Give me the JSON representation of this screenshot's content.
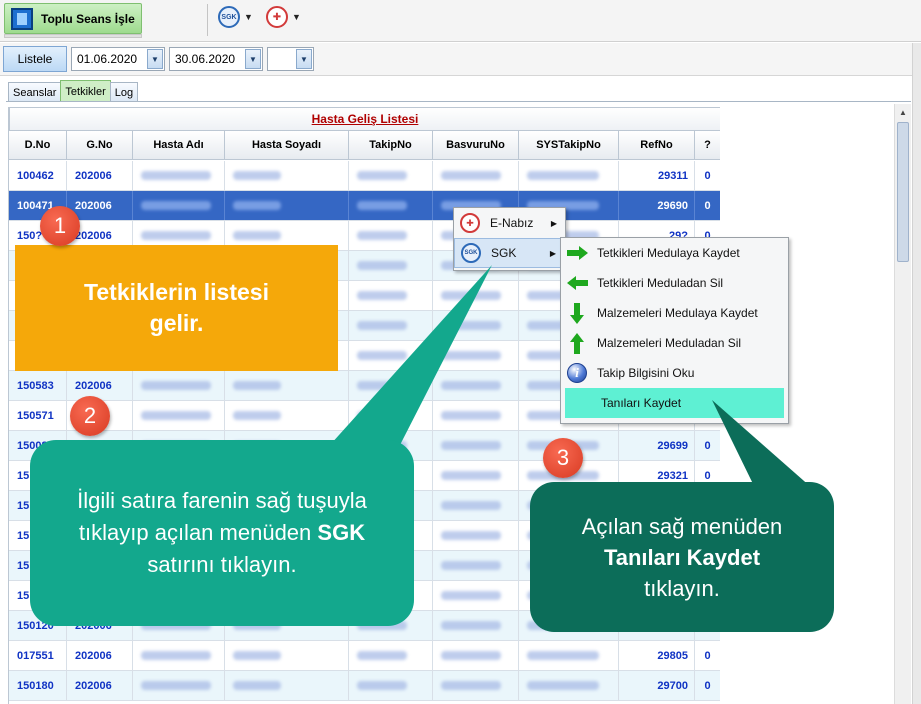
{
  "toolbar": {
    "toplu_label": "Toplu Seans İşle",
    "sgk_logo": "SGK",
    "enabiz_logo": "✚"
  },
  "filter": {
    "listele_label": "Listele",
    "start_date": "01.06.2020",
    "end_date": "30.06.2020",
    "extra_value": ""
  },
  "tabs": [
    {
      "label": "Seanslar"
    },
    {
      "label": "Tetkikler"
    },
    {
      "label": "Log"
    }
  ],
  "grid": {
    "title": "Hasta Geliş Listesi",
    "columns": [
      "D.No",
      "G.No",
      "Hasta Adı",
      "Hasta Soyadı",
      "TakipNo",
      "BasvuruNo",
      "SYSTakipNo",
      "RefNo",
      "?"
    ],
    "rows": [
      {
        "dno": "100462",
        "gno": "202006",
        "refno": "29311",
        "q": "0"
      },
      {
        "dno": "100471",
        "gno": "202006",
        "refno": "29690",
        "q": "0"
      },
      {
        "dno": "150?",
        "gno": "202006",
        "refno": "29?",
        "q": "0"
      },
      {
        "dno": "",
        "gno": "",
        "refno": "",
        "q": ""
      },
      {
        "dno": "",
        "gno": "",
        "refno": "",
        "q": ""
      },
      {
        "dno": "",
        "gno": "",
        "refno": "",
        "q": ""
      },
      {
        "dno": "",
        "gno": "",
        "refno": "",
        "q": ""
      },
      {
        "dno": "150583",
        "gno": "202006",
        "refno": "",
        "q": ""
      },
      {
        "dno": "150571",
        "gno": "?06",
        "refno": "",
        "q": ""
      },
      {
        "dno": "150080",
        "gno": "",
        "refno": "29699",
        "q": "0"
      },
      {
        "dno": "15",
        "gno": "",
        "refno": "29321",
        "q": "0"
      },
      {
        "dno": "15",
        "gno": "",
        "refno": "",
        "q": ""
      },
      {
        "dno": "15",
        "gno": "",
        "refno": "",
        "q": ""
      },
      {
        "dno": "15",
        "gno": "",
        "refno": "",
        "q": ""
      },
      {
        "dno": "15",
        "gno": "",
        "refno": "",
        "q": ""
      },
      {
        "dno": "150120",
        "gno": "202006",
        "refno": "",
        "q": ""
      },
      {
        "dno": "017551",
        "gno": "202006",
        "refno": "29805",
        "q": "0"
      },
      {
        "dno": "150180",
        "gno": "202006",
        "refno": "29700",
        "q": "0"
      }
    ]
  },
  "context_menu": {
    "items": [
      {
        "label": "E-Nabız",
        "icon": "enabiz-icon"
      },
      {
        "label": "SGK",
        "icon": "sgk-icon"
      }
    ]
  },
  "sgk_submenu": {
    "items": [
      {
        "label": "Tetkikleri Medulaya Kaydet",
        "icon": "arrow-right-icon"
      },
      {
        "label": "Tetkikleri Meduladan Sil",
        "icon": "arrow-left-icon"
      },
      {
        "label": "Malzemeleri Medulaya Kaydet",
        "icon": "arrow-down-icon"
      },
      {
        "label": "Malzemeleri Meduladan Sil",
        "icon": "arrow-up-icon"
      },
      {
        "label": "Takip Bilgisini Oku",
        "icon": "info-icon"
      },
      {
        "label": "Tanıları Kaydet",
        "icon": ""
      }
    ]
  },
  "annotations": {
    "badge1": "1",
    "badge2": "2",
    "badge3": "3",
    "callout1": "Tetkiklerin listesi gelir.",
    "callout2_a": "İlgili satıra farenin sağ tuşuyla tıklayıp açılan menüden",
    "callout2_b": "SGK",
    "callout2_c": "satırını tıklayın.",
    "callout3_a": "Açılan sağ menüden",
    "callout3_b": "Tanıları Kaydet",
    "callout3_c": "tıklayın."
  },
  "colors": {
    "accent_green": "#9edb8e",
    "selection_blue": "#3567c4",
    "orange": "#f5a80a",
    "teal": "#13a88d",
    "dark_teal": "#0c6d59",
    "highlight": "#5ef0d3"
  }
}
